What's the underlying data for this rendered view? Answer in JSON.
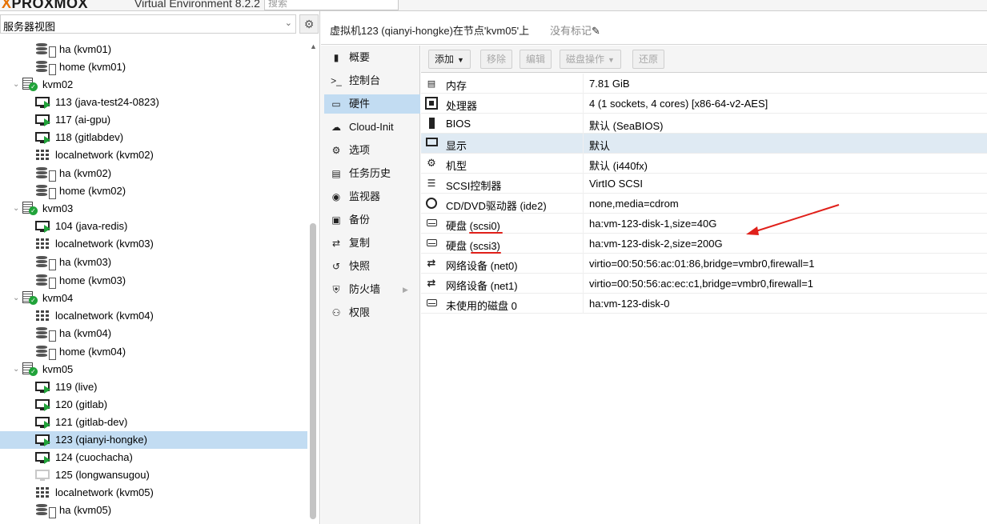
{
  "app": {
    "logo_text": "PROXMOX",
    "product": "Virtual Environment 8.2.2",
    "search_placeholder": "搜索"
  },
  "left_panel": {
    "view_selector": "服务器视图",
    "tree": [
      {
        "kind": "storage",
        "label": "ha (kvm01)",
        "level": 2
      },
      {
        "kind": "storage",
        "label": "home (kvm01)",
        "level": 2
      },
      {
        "kind": "node",
        "label": "kvm02",
        "level": 1
      },
      {
        "kind": "vm",
        "label": "113 (java-test24-0823)",
        "level": 2
      },
      {
        "kind": "vm",
        "label": "117 (ai-gpu)",
        "level": 2
      },
      {
        "kind": "vm",
        "label": "118 (gitlabdev)",
        "level": 2
      },
      {
        "kind": "network",
        "label": "localnetwork (kvm02)",
        "level": 2
      },
      {
        "kind": "storage",
        "label": "ha (kvm02)",
        "level": 2
      },
      {
        "kind": "storage",
        "label": "home (kvm02)",
        "level": 2
      },
      {
        "kind": "node",
        "label": "kvm03",
        "level": 1
      },
      {
        "kind": "vm",
        "label": "104 (java-redis)",
        "level": 2
      },
      {
        "kind": "network",
        "label": "localnetwork (kvm03)",
        "level": 2
      },
      {
        "kind": "storage",
        "label": "ha (kvm03)",
        "level": 2
      },
      {
        "kind": "storage",
        "label": "home (kvm03)",
        "level": 2
      },
      {
        "kind": "node",
        "label": "kvm04",
        "level": 1
      },
      {
        "kind": "network",
        "label": "localnetwork (kvm04)",
        "level": 2
      },
      {
        "kind": "storage",
        "label": "ha (kvm04)",
        "level": 2
      },
      {
        "kind": "storage",
        "label": "home (kvm04)",
        "level": 2
      },
      {
        "kind": "node",
        "label": "kvm05",
        "level": 1
      },
      {
        "kind": "vm",
        "label": "119 (live)",
        "level": 2
      },
      {
        "kind": "vm",
        "label": "120 (gitlab)",
        "level": 2
      },
      {
        "kind": "vm",
        "label": "121 (gitlab-dev)",
        "level": 2
      },
      {
        "kind": "vm",
        "label": "123 (qianyi-hongke)",
        "level": 2,
        "selected": true
      },
      {
        "kind": "vm",
        "label": "124 (cuochacha)",
        "level": 2
      },
      {
        "kind": "vm-stopped",
        "label": "125 (longwansugou)",
        "level": 2
      },
      {
        "kind": "network",
        "label": "localnetwork (kvm05)",
        "level": 2
      },
      {
        "kind": "storage",
        "label": "ha (kvm05)",
        "level": 2
      }
    ]
  },
  "header": {
    "title": "虚拟机123 (qianyi-hongke)在节点'kvm05'上",
    "tags": "没有标记"
  },
  "nav": [
    {
      "icon": "book-icon",
      "label": "概要"
    },
    {
      "icon": "terminal-icon",
      "label": "控制台"
    },
    {
      "icon": "desktop-icon",
      "label": "硬件",
      "active": true
    },
    {
      "icon": "cloud-icon",
      "label": "Cloud-Init"
    },
    {
      "icon": "gear-icon",
      "label": "选项"
    },
    {
      "icon": "list-icon",
      "label": "任务历史"
    },
    {
      "icon": "eye-icon",
      "label": "监视器"
    },
    {
      "icon": "floppy-icon",
      "label": "备份"
    },
    {
      "icon": "retweet-icon",
      "label": "复制"
    },
    {
      "icon": "history-icon",
      "label": "快照"
    },
    {
      "icon": "shield-icon",
      "label": "防火墙",
      "has_arrow": true
    },
    {
      "icon": "unlock-icon",
      "label": "权限"
    }
  ],
  "toolbar": {
    "add": "添加",
    "remove": "移除",
    "edit": "编辑",
    "disk_action": "磁盘操作",
    "revert": "还原"
  },
  "hardware": [
    {
      "icon": "memory-icon",
      "name": "内存",
      "value": "7.81 GiB"
    },
    {
      "icon": "cpu-icon",
      "name": "处理器",
      "value": "4 (1 sockets, 4 cores) [x86-64-v2-AES]"
    },
    {
      "icon": "bios-icon",
      "name": "BIOS",
      "value": "默认 (SeaBIOS)"
    },
    {
      "icon": "display-icon",
      "name": "显示",
      "value": "默认",
      "highlight": true
    },
    {
      "icon": "machine-icon",
      "name": "机型",
      "value": "默认 (i440fx)"
    },
    {
      "icon": "database-icon",
      "name": "SCSI控制器",
      "value": "VirtIO SCSI"
    },
    {
      "icon": "cdrom-icon",
      "name": "CD/DVD驱动器 (ide2)",
      "value": "none,media=cdrom"
    },
    {
      "icon": "hdd-icon",
      "name": "硬盘 (scsi0)",
      "value": "ha:vm-123-disk-1,size=40G"
    },
    {
      "icon": "hdd-icon",
      "name": "硬盘 (scsi3)",
      "value": "ha:vm-123-disk-2,size=200G"
    },
    {
      "icon": "network-icon",
      "name": "网络设备 (net0)",
      "value": "virtio=00:50:56:ac:01:86,bridge=vmbr0,firewall=1"
    },
    {
      "icon": "network-icon",
      "name": "网络设备 (net1)",
      "value": "virtio=00:50:56:ac:ec:c1,bridge=vmbr0,firewall=1"
    },
    {
      "icon": "hdd-icon",
      "name": "未使用的磁盘 0",
      "value": "ha:vm-123-disk-0"
    }
  ],
  "colors": {
    "selection": "#c2dcf2",
    "running_green": "#21a33a",
    "annotation_red": "#e0201a"
  }
}
